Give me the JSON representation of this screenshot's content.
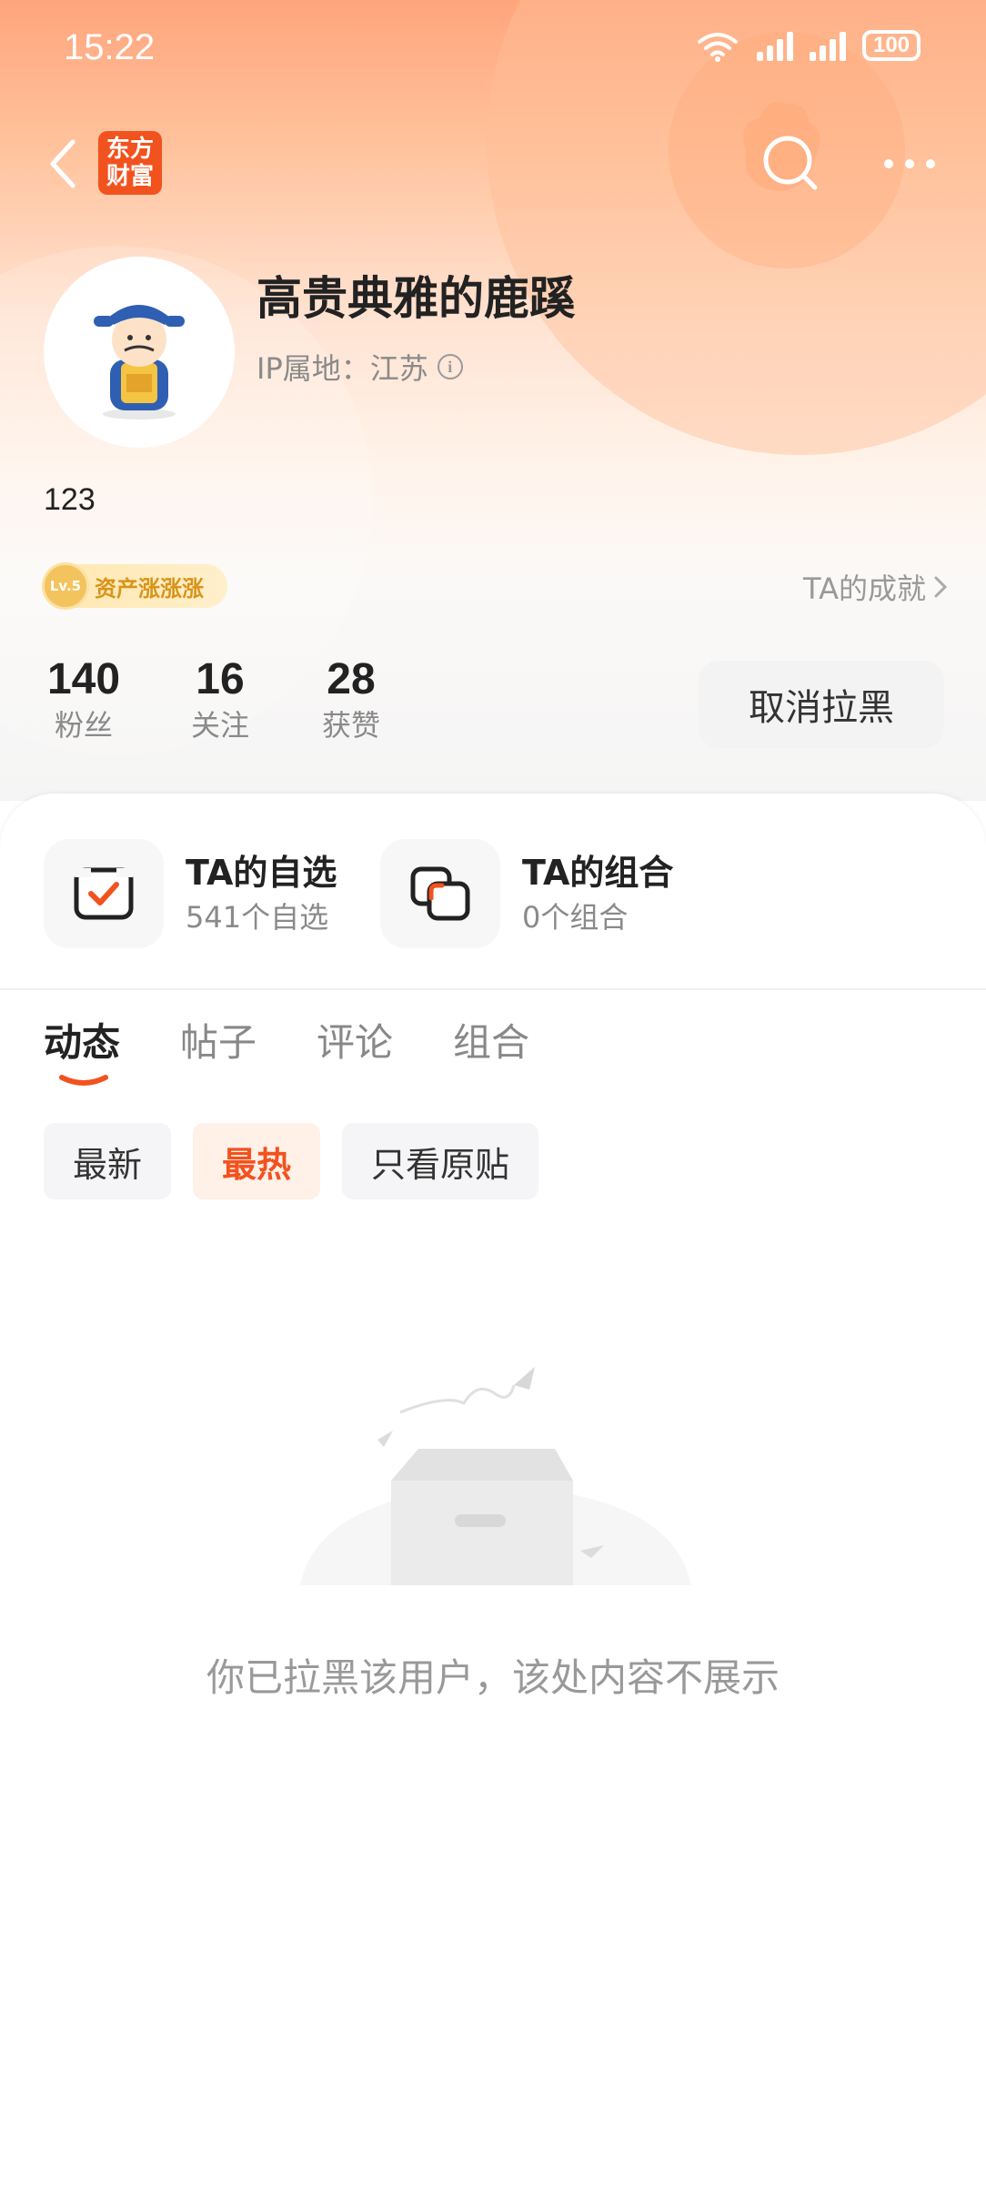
{
  "status_bar": {
    "time": "15:22",
    "battery": "100"
  },
  "nav": {
    "brand_logo_line1": "东方",
    "brand_logo_line2": "财富"
  },
  "profile": {
    "username": "高贵典雅的鹿蹊",
    "ip_location": "IP属地：江苏",
    "bio": "123",
    "level_badge_level": "Lv.5",
    "level_badge_text": "资产涨涨涨",
    "achievements_label": "TA的成就"
  },
  "stats": [
    {
      "value": "140",
      "label": "粉丝"
    },
    {
      "value": "16",
      "label": "关注"
    },
    {
      "value": "28",
      "label": "获赞"
    }
  ],
  "unblock_button": "取消拉黑",
  "features": [
    {
      "title": "TA的自选",
      "subtitle": "541个自选",
      "icon": "checkbox-icon"
    },
    {
      "title": "TA的组合",
      "subtitle": "0个组合",
      "icon": "portfolio-icon"
    }
  ],
  "tabs": [
    "动态",
    "帖子",
    "评论",
    "组合"
  ],
  "active_tab": "动态",
  "filters": [
    "最新",
    "最热",
    "只看原贴"
  ],
  "active_filter": "最热",
  "empty_state": {
    "message": "你已拉黑该用户，该处内容不展示",
    "icon": "empty-box-icon"
  },
  "colors": {
    "accent": "#f2521e",
    "header_gradient_top": "#ffa57c"
  }
}
